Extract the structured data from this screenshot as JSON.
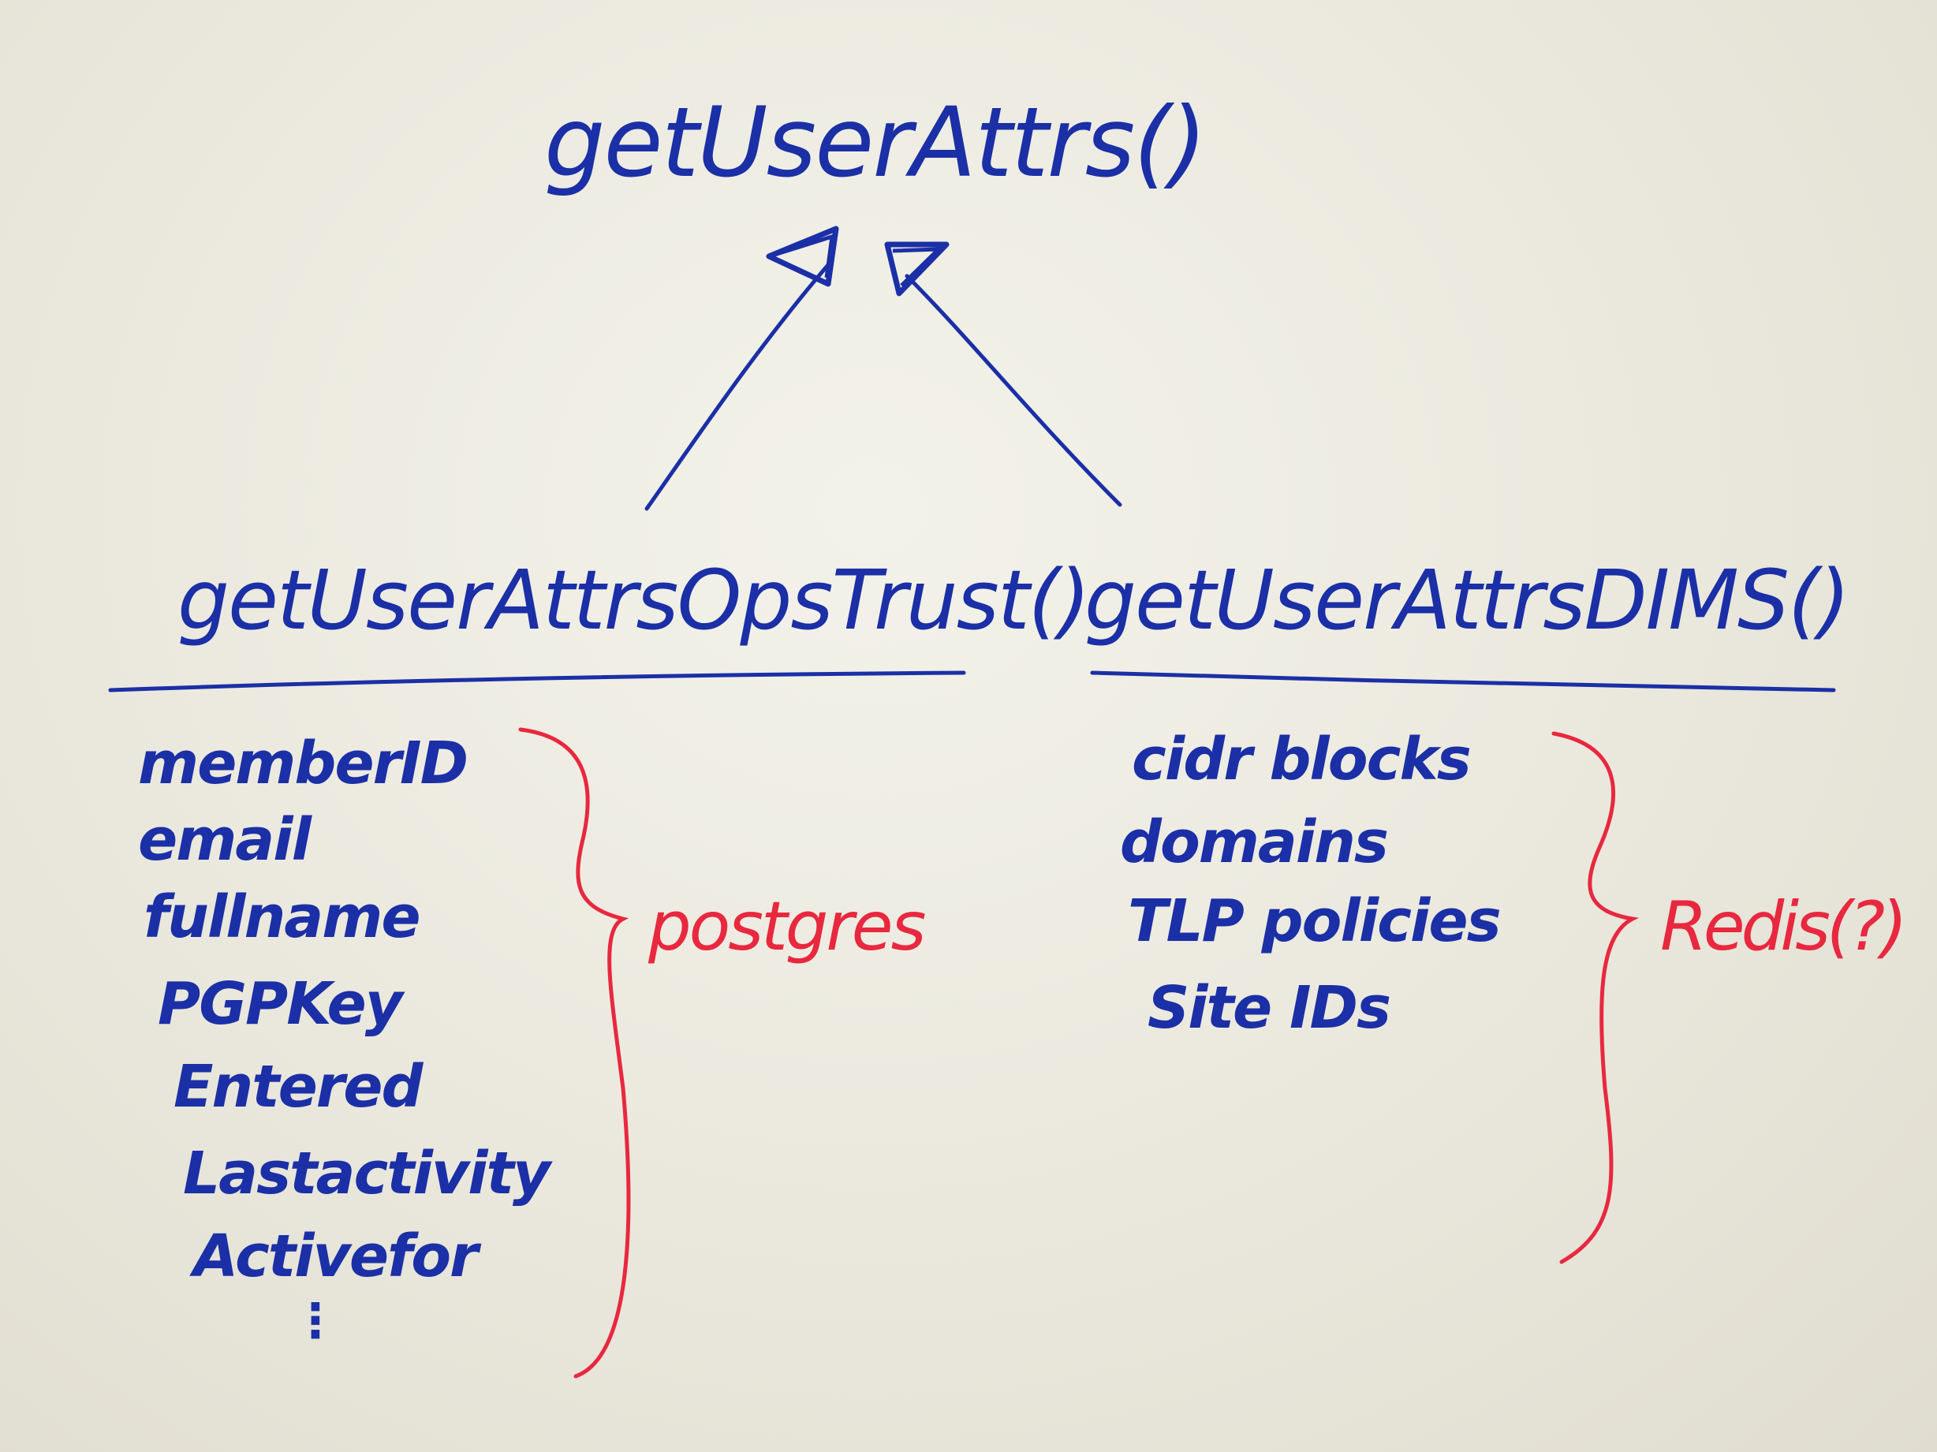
{
  "diagram": {
    "root": {
      "label": "getUserAttrs()"
    },
    "children": [
      {
        "label": "getUserAttrsOpsTrust()",
        "fields": [
          "memberID",
          "email",
          "fullname",
          "PGPKey",
          "Entered",
          "Lastactivity",
          "Activefor"
        ],
        "continuation": "⋮",
        "storage": "postgres"
      },
      {
        "label": "getUserAttrsDIMS()",
        "fields": [
          "cidr blocks",
          "domains",
          "TLP policies",
          "Site IDs"
        ],
        "storage": "Redis(?)"
      }
    ]
  },
  "colors": {
    "marker_blue": "#1b2fa6",
    "marker_red": "#e8283f",
    "board": "#ecebe2"
  }
}
